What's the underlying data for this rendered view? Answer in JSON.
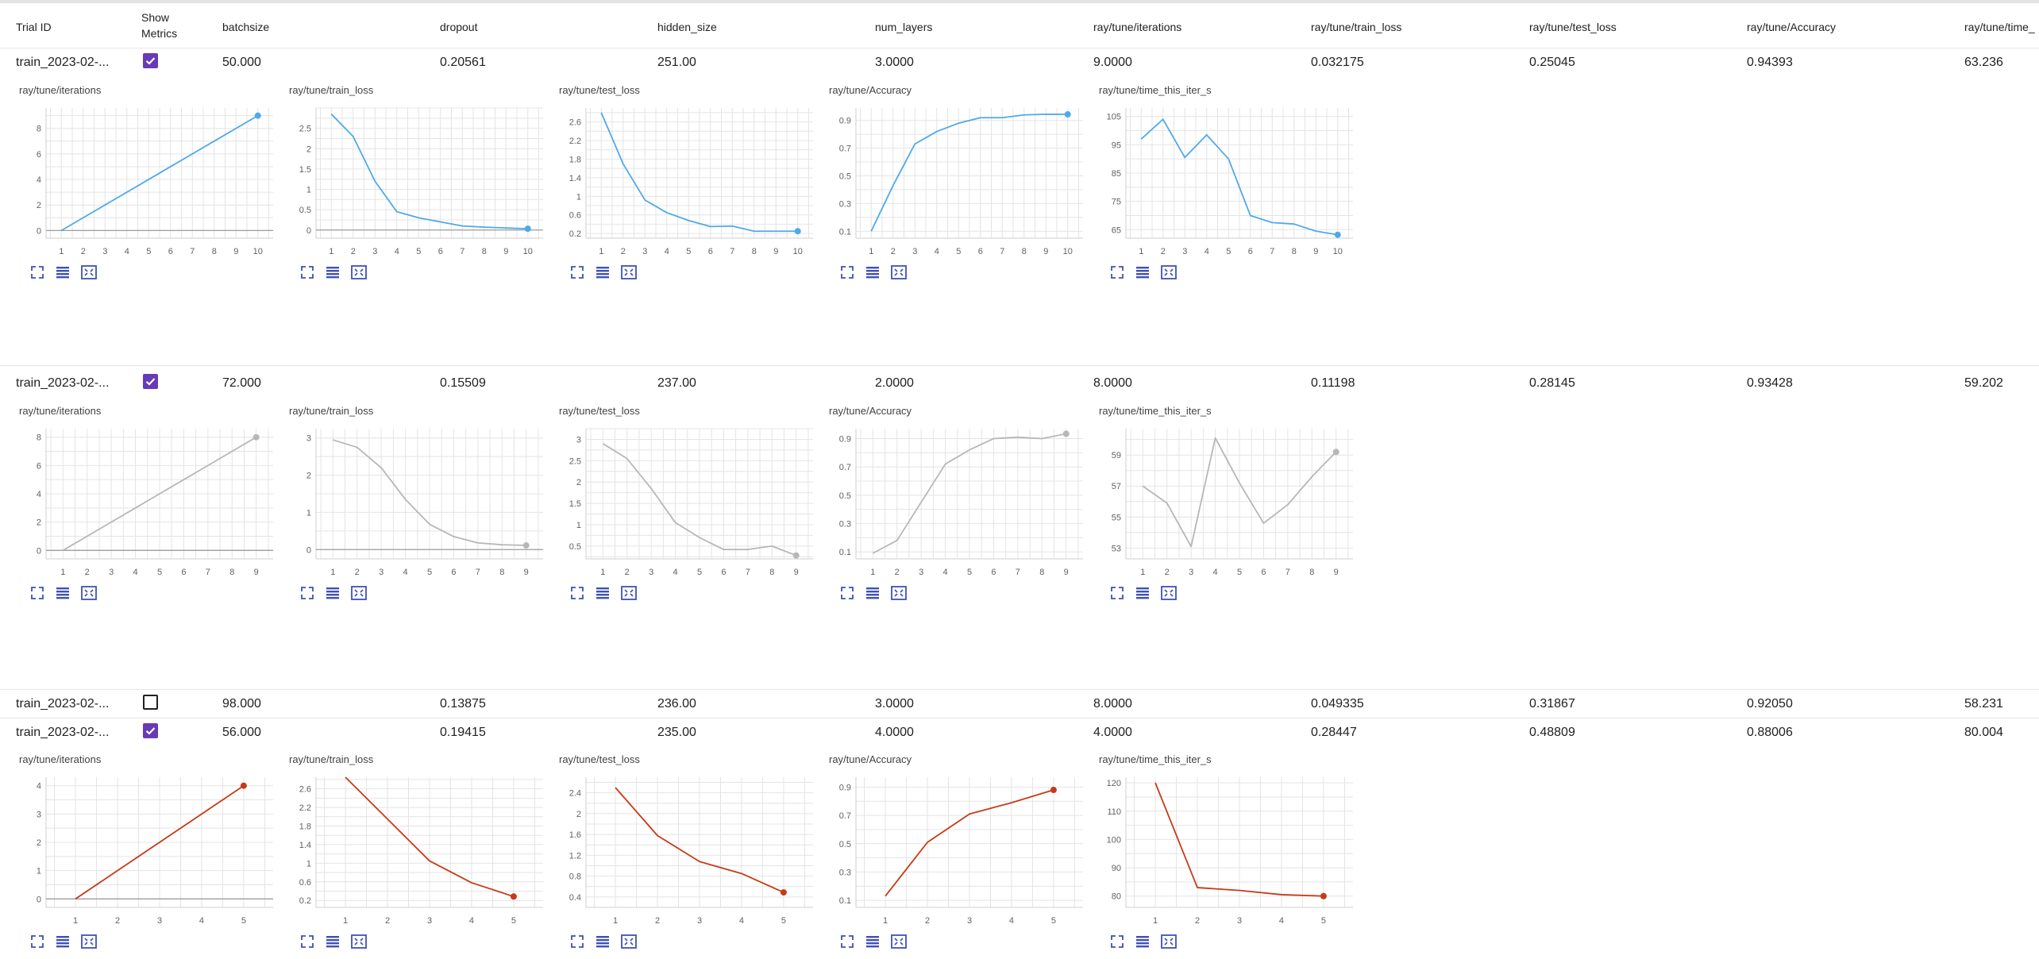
{
  "columns": [
    "Trial ID",
    "Show Metrics",
    "batchsize",
    "dropout",
    "hidden_size",
    "num_layers",
    "ray/tune/iterations",
    "ray/tune/train_loss",
    "ray/tune/test_loss",
    "ray/tune/Accuracy",
    "ray/tune/time_"
  ],
  "trials": [
    {
      "trial_id": "train_2023-02-...",
      "show_metrics": true,
      "batchsize": "50.000",
      "dropout": "0.20561",
      "hidden_size": "251.00",
      "num_layers": "3.0000",
      "iterations": "9.0000",
      "train_loss": "0.032175",
      "test_loss": "0.25045",
      "accuracy": "0.94393",
      "time": "63.236"
    },
    {
      "trial_id": "train_2023-02-...",
      "show_metrics": true,
      "batchsize": "72.000",
      "dropout": "0.15509",
      "hidden_size": "237.00",
      "num_layers": "2.0000",
      "iterations": "8.0000",
      "train_loss": "0.11198",
      "test_loss": "0.28145",
      "accuracy": "0.93428",
      "time": "59.202"
    },
    {
      "trial_id": "train_2023-02-...",
      "show_metrics": false,
      "batchsize": "98.000",
      "dropout": "0.13875",
      "hidden_size": "236.00",
      "num_layers": "3.0000",
      "iterations": "8.0000",
      "train_loss": "0.049335",
      "test_loss": "0.31867",
      "accuracy": "0.92050",
      "time": "58.231"
    },
    {
      "trial_id": "train_2023-02-...",
      "show_metrics": true,
      "batchsize": "56.000",
      "dropout": "0.19415",
      "hidden_size": "235.00",
      "num_layers": "4.0000",
      "iterations": "4.0000",
      "train_loss": "0.28447",
      "test_loss": "0.48809",
      "accuracy": "0.88006",
      "time": "80.004"
    }
  ],
  "colors": {
    "blue": "#4fa9e8",
    "gray": "#b7b7b7",
    "red": "#c73a17",
    "accent": "#673ab7"
  },
  "icons": [
    "fullscreen-icon",
    "list-icon",
    "fit-domain-icon"
  ],
  "chart_data": [
    {
      "trial": 0,
      "color": "#4fa9e8",
      "charts": [
        {
          "type": "line",
          "title": "ray/tune/iterations",
          "x": [
            1,
            2,
            3,
            4,
            5,
            6,
            7,
            8,
            9,
            10
          ],
          "y": [
            0,
            1,
            2,
            3,
            4,
            5,
            6,
            7,
            8,
            9
          ],
          "yticks": [
            "0",
            "2",
            "4",
            "6",
            "8"
          ],
          "ytick_values": [
            0,
            2,
            4,
            6,
            8
          ],
          "ylim": [
            -0.6,
            9.6
          ],
          "zero_line": true
        },
        {
          "type": "line",
          "title": "ray/tune/train_loss",
          "x": [
            1,
            2,
            3,
            4,
            5,
            6,
            7,
            8,
            9,
            10
          ],
          "y": [
            2.85,
            2.3,
            1.2,
            0.45,
            0.3,
            0.2,
            0.1,
            0.07,
            0.05,
            0.032
          ],
          "yticks": [
            "0",
            "0.5",
            "1",
            "1.5",
            "2",
            "2.5"
          ],
          "ytick_values": [
            0,
            0.5,
            1,
            1.5,
            2,
            2.5
          ],
          "ylim": [
            -0.2,
            3.0
          ],
          "zero_line": true
        },
        {
          "type": "line",
          "title": "ray/tune/test_loss",
          "x": [
            1,
            2,
            3,
            4,
            5,
            6,
            7,
            8,
            9,
            10
          ],
          "y": [
            2.8,
            1.7,
            0.92,
            0.65,
            0.48,
            0.35,
            0.36,
            0.25,
            0.25,
            0.25
          ],
          "yticks": [
            "0.2",
            "0.6",
            "1",
            "1.4",
            "1.8",
            "2.2",
            "2.6"
          ],
          "ytick_values": [
            0.2,
            0.6,
            1,
            1.4,
            1.8,
            2.2,
            2.6
          ],
          "ylim": [
            0.1,
            2.9
          ],
          "zero_line": false
        },
        {
          "type": "line",
          "title": "ray/tune/Accuracy",
          "x": [
            1,
            2,
            3,
            4,
            5,
            6,
            7,
            8,
            9,
            10
          ],
          "y": [
            0.1,
            0.43,
            0.73,
            0.82,
            0.88,
            0.92,
            0.92,
            0.94,
            0.945,
            0.944
          ],
          "yticks": [
            "0.1",
            "0.3",
            "0.5",
            "0.7",
            "0.9"
          ],
          "ytick_values": [
            0.1,
            0.3,
            0.5,
            0.7,
            0.9
          ],
          "ylim": [
            0.05,
            0.99
          ],
          "zero_line": false
        },
        {
          "type": "line",
          "title": "ray/tune/time_this_iter_s",
          "x": [
            1,
            2,
            3,
            4,
            5,
            6,
            7,
            8,
            9,
            10
          ],
          "y": [
            97,
            104,
            90.5,
            98.5,
            90,
            70,
            67.5,
            67,
            64.5,
            63.2
          ],
          "yticks": [
            "65",
            "75",
            "85",
            "95",
            "105"
          ],
          "ytick_values": [
            65,
            75,
            85,
            95,
            105
          ],
          "ylim": [
            62,
            108
          ],
          "zero_line": false
        }
      ]
    },
    {
      "trial": 1,
      "color": "#b7b7b7",
      "charts": [
        {
          "type": "line",
          "title": "ray/tune/iterations",
          "x": [
            1,
            2,
            3,
            4,
            5,
            6,
            7,
            8,
            9
          ],
          "y": [
            0,
            1,
            2,
            3,
            4,
            5,
            6,
            7,
            8
          ],
          "yticks": [
            "0",
            "2",
            "4",
            "6",
            "8"
          ],
          "ytick_values": [
            0,
            2,
            4,
            6,
            8
          ],
          "ylim": [
            -0.6,
            8.6
          ],
          "zero_line": true
        },
        {
          "type": "line",
          "title": "ray/tune/train_loss",
          "x": [
            1,
            2,
            3,
            4,
            5,
            6,
            7,
            8,
            9
          ],
          "y": [
            2.95,
            2.75,
            2.2,
            1.35,
            0.68,
            0.35,
            0.18,
            0.13,
            0.112
          ],
          "yticks": [
            "0",
            "1",
            "2",
            "3"
          ],
          "ytick_values": [
            0,
            1,
            2,
            3
          ],
          "ylim": [
            -0.25,
            3.25
          ],
          "zero_line": true
        },
        {
          "type": "line",
          "title": "ray/tune/test_loss",
          "x": [
            1,
            2,
            3,
            4,
            5,
            6,
            7,
            8,
            9
          ],
          "y": [
            2.9,
            2.55,
            1.85,
            1.05,
            0.7,
            0.42,
            0.42,
            0.5,
            0.28
          ],
          "yticks": [
            "0.5",
            "1",
            "1.5",
            "2",
            "2.5",
            "3"
          ],
          "ytick_values": [
            0.5,
            1,
            1.5,
            2,
            2.5,
            3
          ],
          "ylim": [
            0.2,
            3.25
          ],
          "zero_line": false
        },
        {
          "type": "line",
          "title": "ray/tune/Accuracy",
          "x": [
            1,
            2,
            3,
            4,
            5,
            6,
            7,
            8,
            9
          ],
          "y": [
            0.09,
            0.18,
            0.45,
            0.72,
            0.82,
            0.9,
            0.91,
            0.9,
            0.934
          ],
          "yticks": [
            "0.1",
            "0.3",
            "0.5",
            "0.7",
            "0.9"
          ],
          "ytick_values": [
            0.1,
            0.3,
            0.5,
            0.7,
            0.9
          ],
          "ylim": [
            0.05,
            0.97
          ],
          "zero_line": false
        },
        {
          "type": "line",
          "title": "ray/tune/time_this_iter_s",
          "x": [
            1,
            2,
            3,
            4,
            5,
            6,
            7,
            8,
            9
          ],
          "y": [
            57,
            55.9,
            53.1,
            60.1,
            57.2,
            54.6,
            55.8,
            57.6,
            59.2
          ],
          "yticks": [
            "53",
            "55",
            "57",
            "59"
          ],
          "ytick_values": [
            53,
            55,
            57,
            59
          ],
          "ylim": [
            52.3,
            60.7
          ],
          "zero_line": false
        }
      ]
    },
    {
      "trial": 3,
      "color": "#c73a17",
      "charts": [
        {
          "type": "line",
          "title": "ray/tune/iterations",
          "x": [
            1,
            2,
            3,
            4,
            5
          ],
          "y": [
            0,
            1,
            2,
            3,
            4
          ],
          "yticks": [
            "0",
            "1",
            "2",
            "3",
            "4"
          ],
          "ytick_values": [
            0,
            1,
            2,
            3,
            4
          ],
          "ylim": [
            -0.3,
            4.3
          ],
          "zero_line": true
        },
        {
          "type": "line",
          "title": "ray/tune/train_loss",
          "x": [
            1,
            2,
            3,
            4,
            5
          ],
          "y": [
            2.85,
            1.95,
            1.05,
            0.58,
            0.284
          ],
          "yticks": [
            "0.2",
            "0.6",
            "1",
            "1.4",
            "1.8",
            "2.2",
            "2.6"
          ],
          "ytick_values": [
            0.2,
            0.6,
            1,
            1.4,
            1.8,
            2.2,
            2.6
          ],
          "ylim": [
            0.05,
            2.85
          ],
          "zero_line": false
        },
        {
          "type": "line",
          "title": "ray/tune/test_loss",
          "x": [
            1,
            2,
            3,
            4,
            5
          ],
          "y": [
            2.5,
            1.58,
            1.08,
            0.85,
            0.488
          ],
          "yticks": [
            "0.4",
            "0.8",
            "1.2",
            "1.6",
            "2",
            "2.4"
          ],
          "ytick_values": [
            0.4,
            0.8,
            1.2,
            1.6,
            2,
            2.4
          ],
          "ylim": [
            0.2,
            2.7
          ],
          "zero_line": false
        },
        {
          "type": "line",
          "title": "ray/tune/Accuracy",
          "x": [
            1,
            2,
            3,
            4,
            5
          ],
          "y": [
            0.13,
            0.51,
            0.71,
            0.79,
            0.88
          ],
          "yticks": [
            "0.1",
            "0.3",
            "0.5",
            "0.7",
            "0.9"
          ],
          "ytick_values": [
            0.1,
            0.3,
            0.5,
            0.7,
            0.9
          ],
          "ylim": [
            0.05,
            0.97
          ],
          "zero_line": false
        },
        {
          "type": "line",
          "title": "ray/tune/time_this_iter_s",
          "x": [
            1,
            2,
            3,
            4,
            5
          ],
          "y": [
            120,
            83,
            82,
            80.5,
            80
          ],
          "yticks": [
            "80",
            "90",
            "100",
            "110",
            "120"
          ],
          "ytick_values": [
            80,
            90,
            100,
            110,
            120
          ],
          "ylim": [
            76,
            122
          ],
          "zero_line": false
        }
      ]
    }
  ]
}
